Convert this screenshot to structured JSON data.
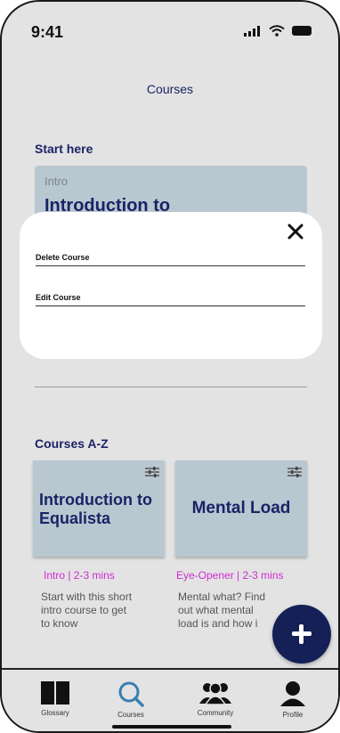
{
  "status_bar": {
    "time": "9:41"
  },
  "page_title": "Courses",
  "start_here": {
    "heading": "Start here",
    "card": {
      "tag": "Intro",
      "title": "Introduction to"
    }
  },
  "popup": {
    "items": [
      "Delete Course",
      "Edit Course"
    ]
  },
  "courses_az": {
    "heading": "Courses A-Z",
    "cards": [
      {
        "title": "Introduction to Equalista",
        "meta": "Intro | 2-3 mins",
        "description_lines": [
          "Start with this short",
          "intro course to get",
          "to know"
        ]
      },
      {
        "title": "Mental Load",
        "meta": "Eye-Opener | 2-3 mins",
        "description_lines": [
          "Mental what? Find",
          "out what  mental",
          "load is and how i"
        ]
      }
    ]
  },
  "tabs": [
    {
      "label": "Glossary",
      "icon": "book-icon"
    },
    {
      "label": "Courses",
      "icon": "search-icon"
    },
    {
      "label": "Community",
      "icon": "community-icon"
    },
    {
      "label": "Profile",
      "icon": "profile-icon"
    }
  ],
  "colors": {
    "brand_navy": "#152057",
    "heading": "#1a2366",
    "card_bg": "#b9c7d0",
    "meta_magenta": "#d12bd1",
    "active_tab": "#3a7fb0"
  }
}
